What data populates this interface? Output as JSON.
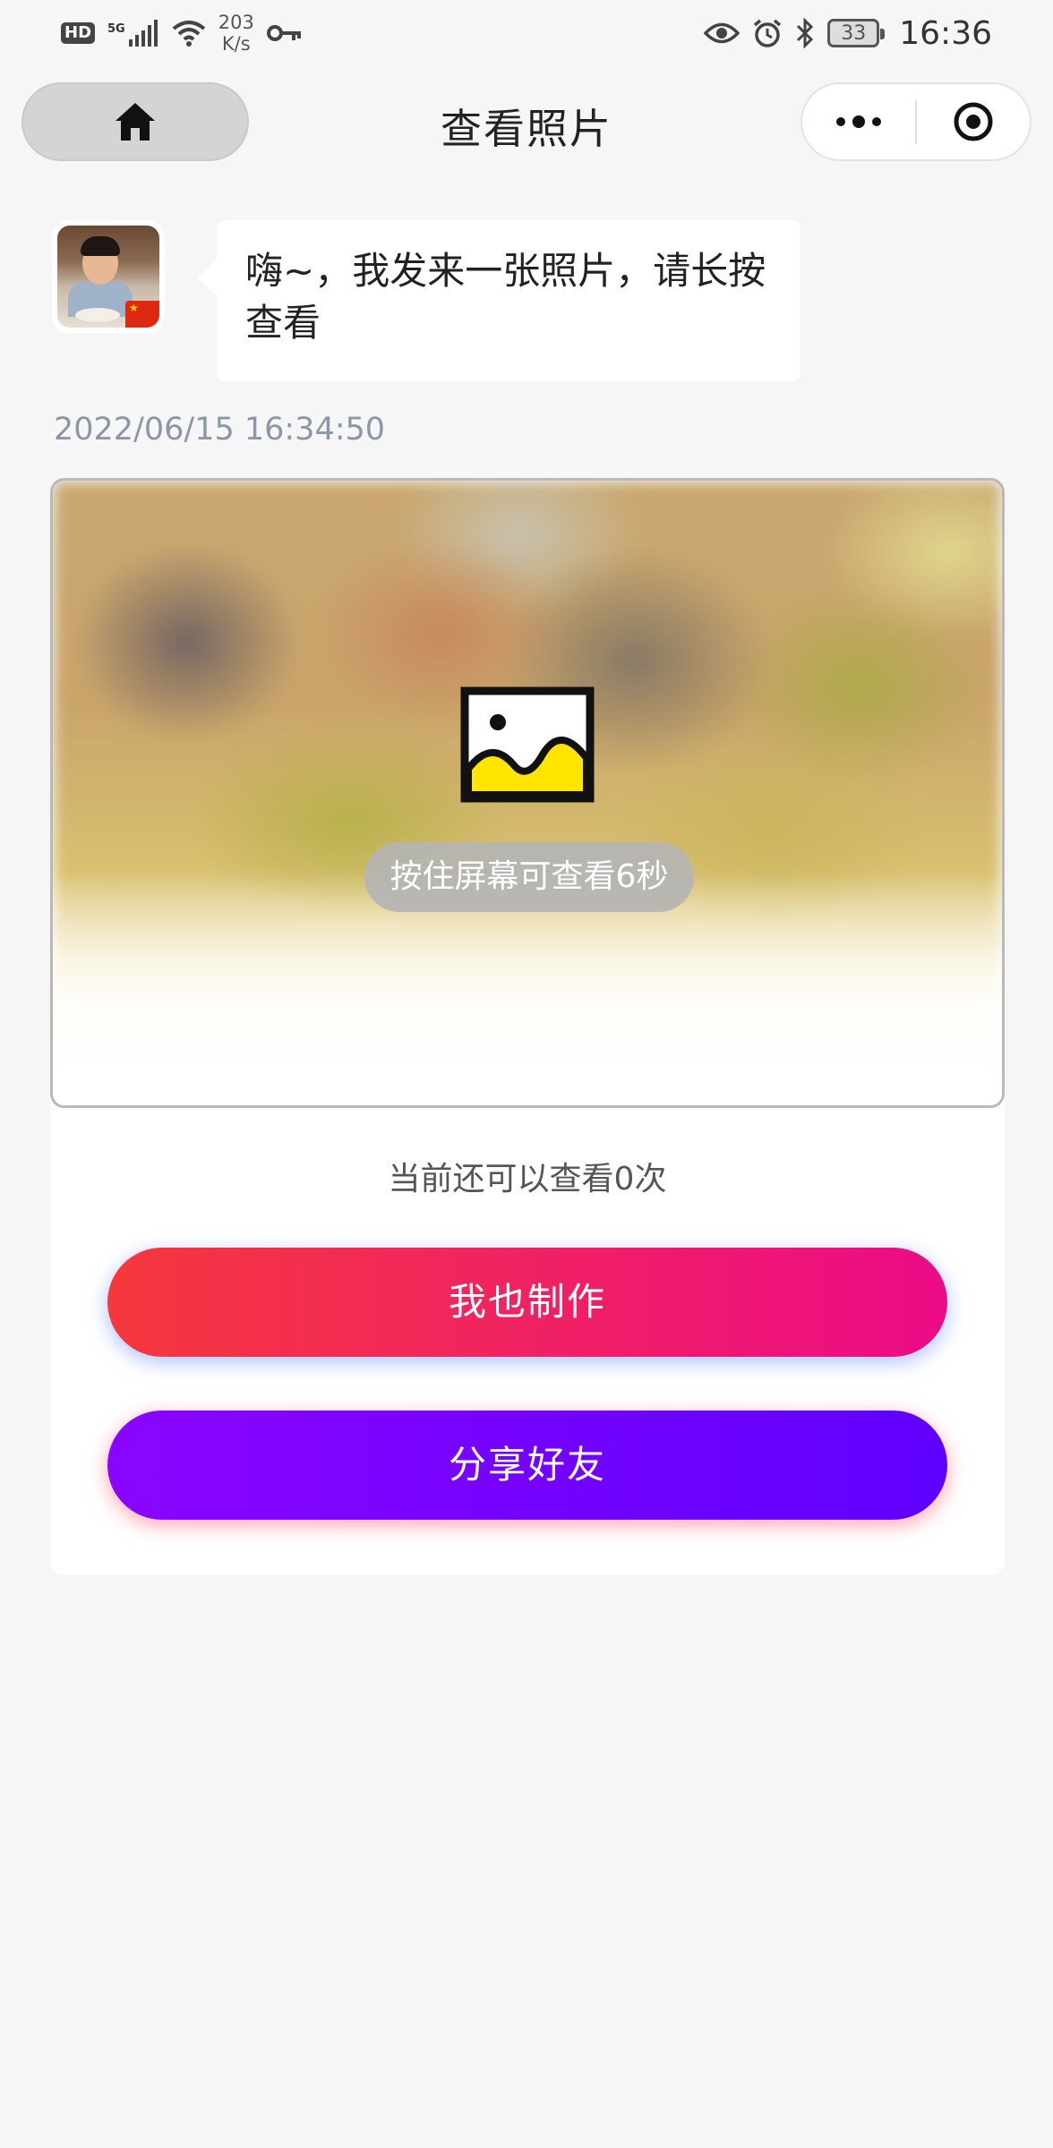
{
  "status_bar": {
    "hd_label": "HD",
    "network_label": "5G",
    "speed_value": "203",
    "speed_unit": "K/s",
    "battery_level": "33",
    "time": "16:36"
  },
  "nav": {
    "title": "查看照片",
    "icons": [
      "home-icon",
      "more-dots-icon",
      "close-target-icon"
    ]
  },
  "message": {
    "text": "嗨~，我发来一张照片，请长按查看",
    "timestamp": "2022/06/15 16:34:50"
  },
  "photo": {
    "hint": "按住屏幕可查看6秒",
    "icon": "image-icon"
  },
  "remaining_views": "当前还可以查看0次",
  "buttons": {
    "make_label": "我也制作",
    "share_label": "分享好友"
  },
  "colors": {
    "make_gradient": [
      "#f5383d",
      "#ec0b87"
    ],
    "share_gradient": [
      "#8a05ff",
      "#5f00ff"
    ],
    "image_icon_fill": "#ffe500"
  }
}
